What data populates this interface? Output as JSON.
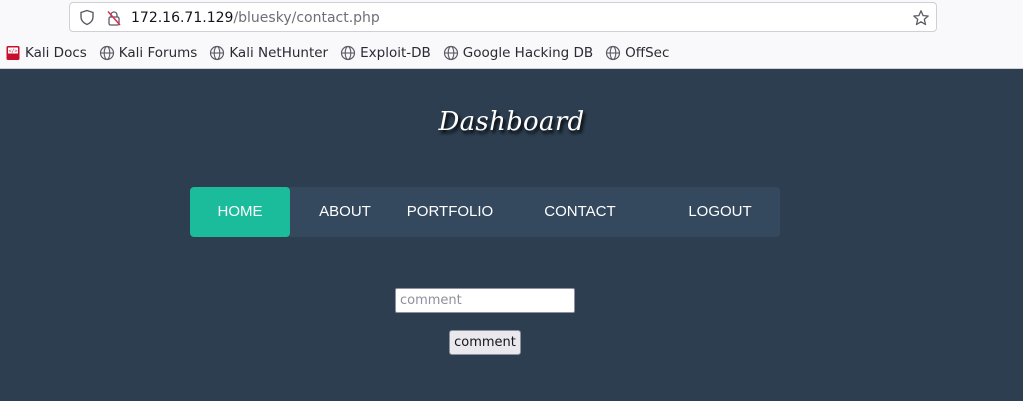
{
  "browser": {
    "url_host": "172.16.71.129",
    "url_path": "/bluesky/contact.php",
    "bookmarks": [
      {
        "label": "Kali Docs",
        "icon": "kali-docs-icon"
      },
      {
        "label": "Kali Forums",
        "icon": "globe-icon"
      },
      {
        "label": "Kali NetHunter",
        "icon": "globe-icon"
      },
      {
        "label": "Exploit-DB",
        "icon": "globe-icon"
      },
      {
        "label": "Google Hacking DB",
        "icon": "globe-icon"
      },
      {
        "label": "OffSec",
        "icon": "globe-icon"
      }
    ]
  },
  "page": {
    "title": "Dashboard",
    "nav": [
      {
        "label": "HOME",
        "active": true
      },
      {
        "label": "ABOUT",
        "active": false
      },
      {
        "label": "PORTFOLIO",
        "active": false
      },
      {
        "label": "CONTACT",
        "active": false
      },
      {
        "label": "LOGOUT",
        "active": false
      }
    ],
    "comment_input": {
      "placeholder": "comment",
      "value": ""
    },
    "comment_button_label": "comment"
  },
  "colors": {
    "page_background": "#2c3e50",
    "nav_background": "#34495e",
    "nav_active": "#1abc9c"
  }
}
